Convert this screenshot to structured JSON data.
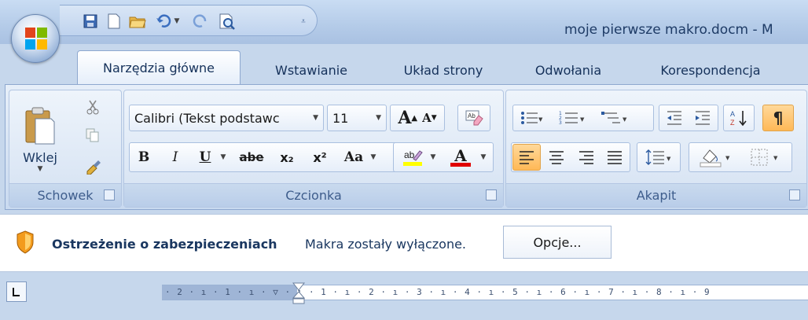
{
  "window": {
    "title": "moje pierwsze makro.docm - M"
  },
  "tabs": [
    {
      "label": "Narzędzia główne",
      "active": true
    },
    {
      "label": "Wstawianie"
    },
    {
      "label": "Układ strony"
    },
    {
      "label": "Odwołania"
    },
    {
      "label": "Korespondencja"
    }
  ],
  "clipboard": {
    "group_label": "Schowek",
    "paste_label": "Wklej"
  },
  "font": {
    "group_label": "Czcionka",
    "font_name": "Calibri (Tekst podstawc",
    "font_size": "11"
  },
  "paragraph": {
    "group_label": "Akapit"
  },
  "security_bar": {
    "title": "Ostrzeżenie o zabezpieczeniach",
    "message": "Makra zostały wyłączone.",
    "options_label": "Opcje..."
  },
  "ruler": {
    "text": "· 2 · ı · 1 · ı · ▽ · ı · 1 · ı · 2 · ı · 3 · ı · 4 · ı · 5 · ı · 6 · ı · 7 · ı · 8 · ı · 9"
  },
  "font_buttons": {
    "bold": "B",
    "italic": "I",
    "underline": "U",
    "strike": "abe",
    "sub": "x₂",
    "sup": "x²",
    "case": "Aa",
    "grow": "A",
    "shrink": "A"
  },
  "colors": {
    "highlight": "#ffff00",
    "font_color": "#e00000",
    "accent": "#ffb957"
  }
}
